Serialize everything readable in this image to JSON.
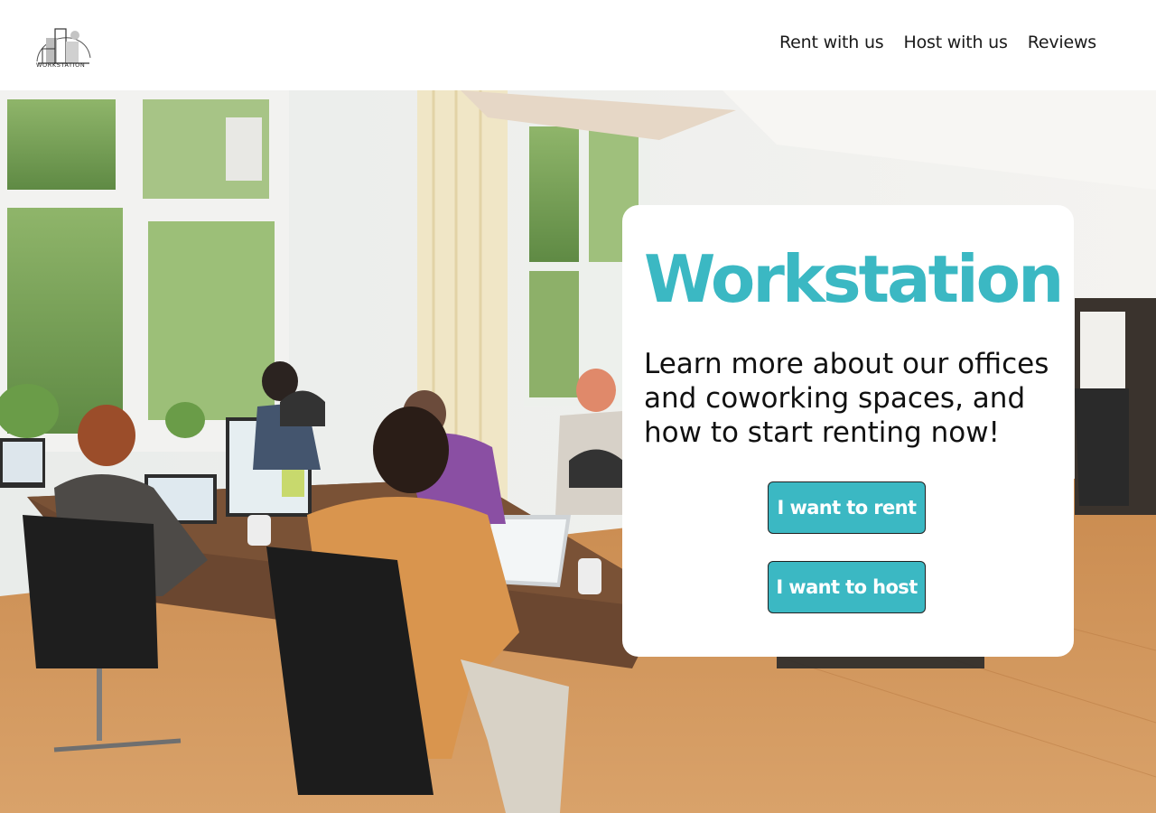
{
  "header": {
    "logo_text": "WORKSTATION",
    "nav": [
      {
        "label": "Rent with us"
      },
      {
        "label": "Host with us"
      },
      {
        "label": "Reviews"
      }
    ]
  },
  "hero": {
    "image_icon": "coworking-office-photo"
  },
  "card": {
    "title": "Workstation",
    "description": "Learn more about our offices and coworking spaces, and how to start renting now!",
    "rent_button": "I want to rent",
    "host_button": "I want to host"
  },
  "colors": {
    "accent": "#3bb8c3",
    "text": "#111111",
    "background": "#ffffff"
  }
}
